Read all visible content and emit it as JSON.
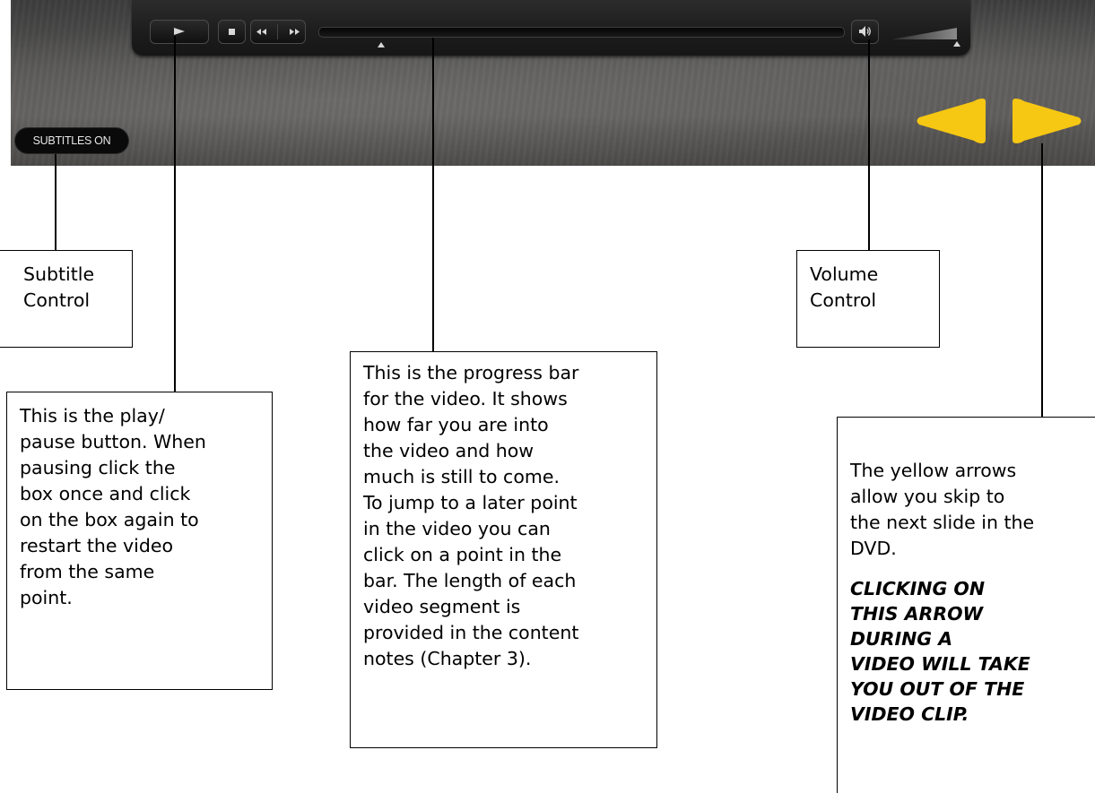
{
  "player": {
    "subtitles_label": "SUBTITLES ON",
    "progress": 0.12,
    "volume": 1.0,
    "icons": {
      "play": "play-icon",
      "stop": "stop-icon",
      "rewind": "rewind-icon",
      "fast_forward": "fast-forward-icon",
      "volume": "speaker-icon",
      "prev": "yellow-left-arrow-icon",
      "next": "yellow-right-arrow-icon"
    },
    "colors": {
      "arrow": "#f6c713",
      "bar": "#1c1c1c",
      "background": "#575554"
    }
  },
  "callouts": {
    "subtitle": "Subtitle\nControl",
    "volume": "Volume\nControl",
    "play": "This is the play/\npause button. When\npausing click the\nbox once and click\non the box again to\nrestart the video\nfrom the same\npoint.",
    "progress": "This is the progress bar\nfor the video. It shows\nhow far you are into\nthe video and how\nmuch is still to come.\nTo jump to a later point\nin the video you can\nclick on a point in the\nbar. The length of each\nvideo segment is\nprovided in the content\nnotes (Chapter 3).",
    "arrows": "The yellow arrows\nallow you skip to\nthe next slide in the\nDVD.",
    "arrows_warning": "CLICKING ON\nTHIS ARROW\nDURING A\nVIDEO WILL TAKE\nYOU OUT OF THE\nVIDEO CLIP."
  }
}
